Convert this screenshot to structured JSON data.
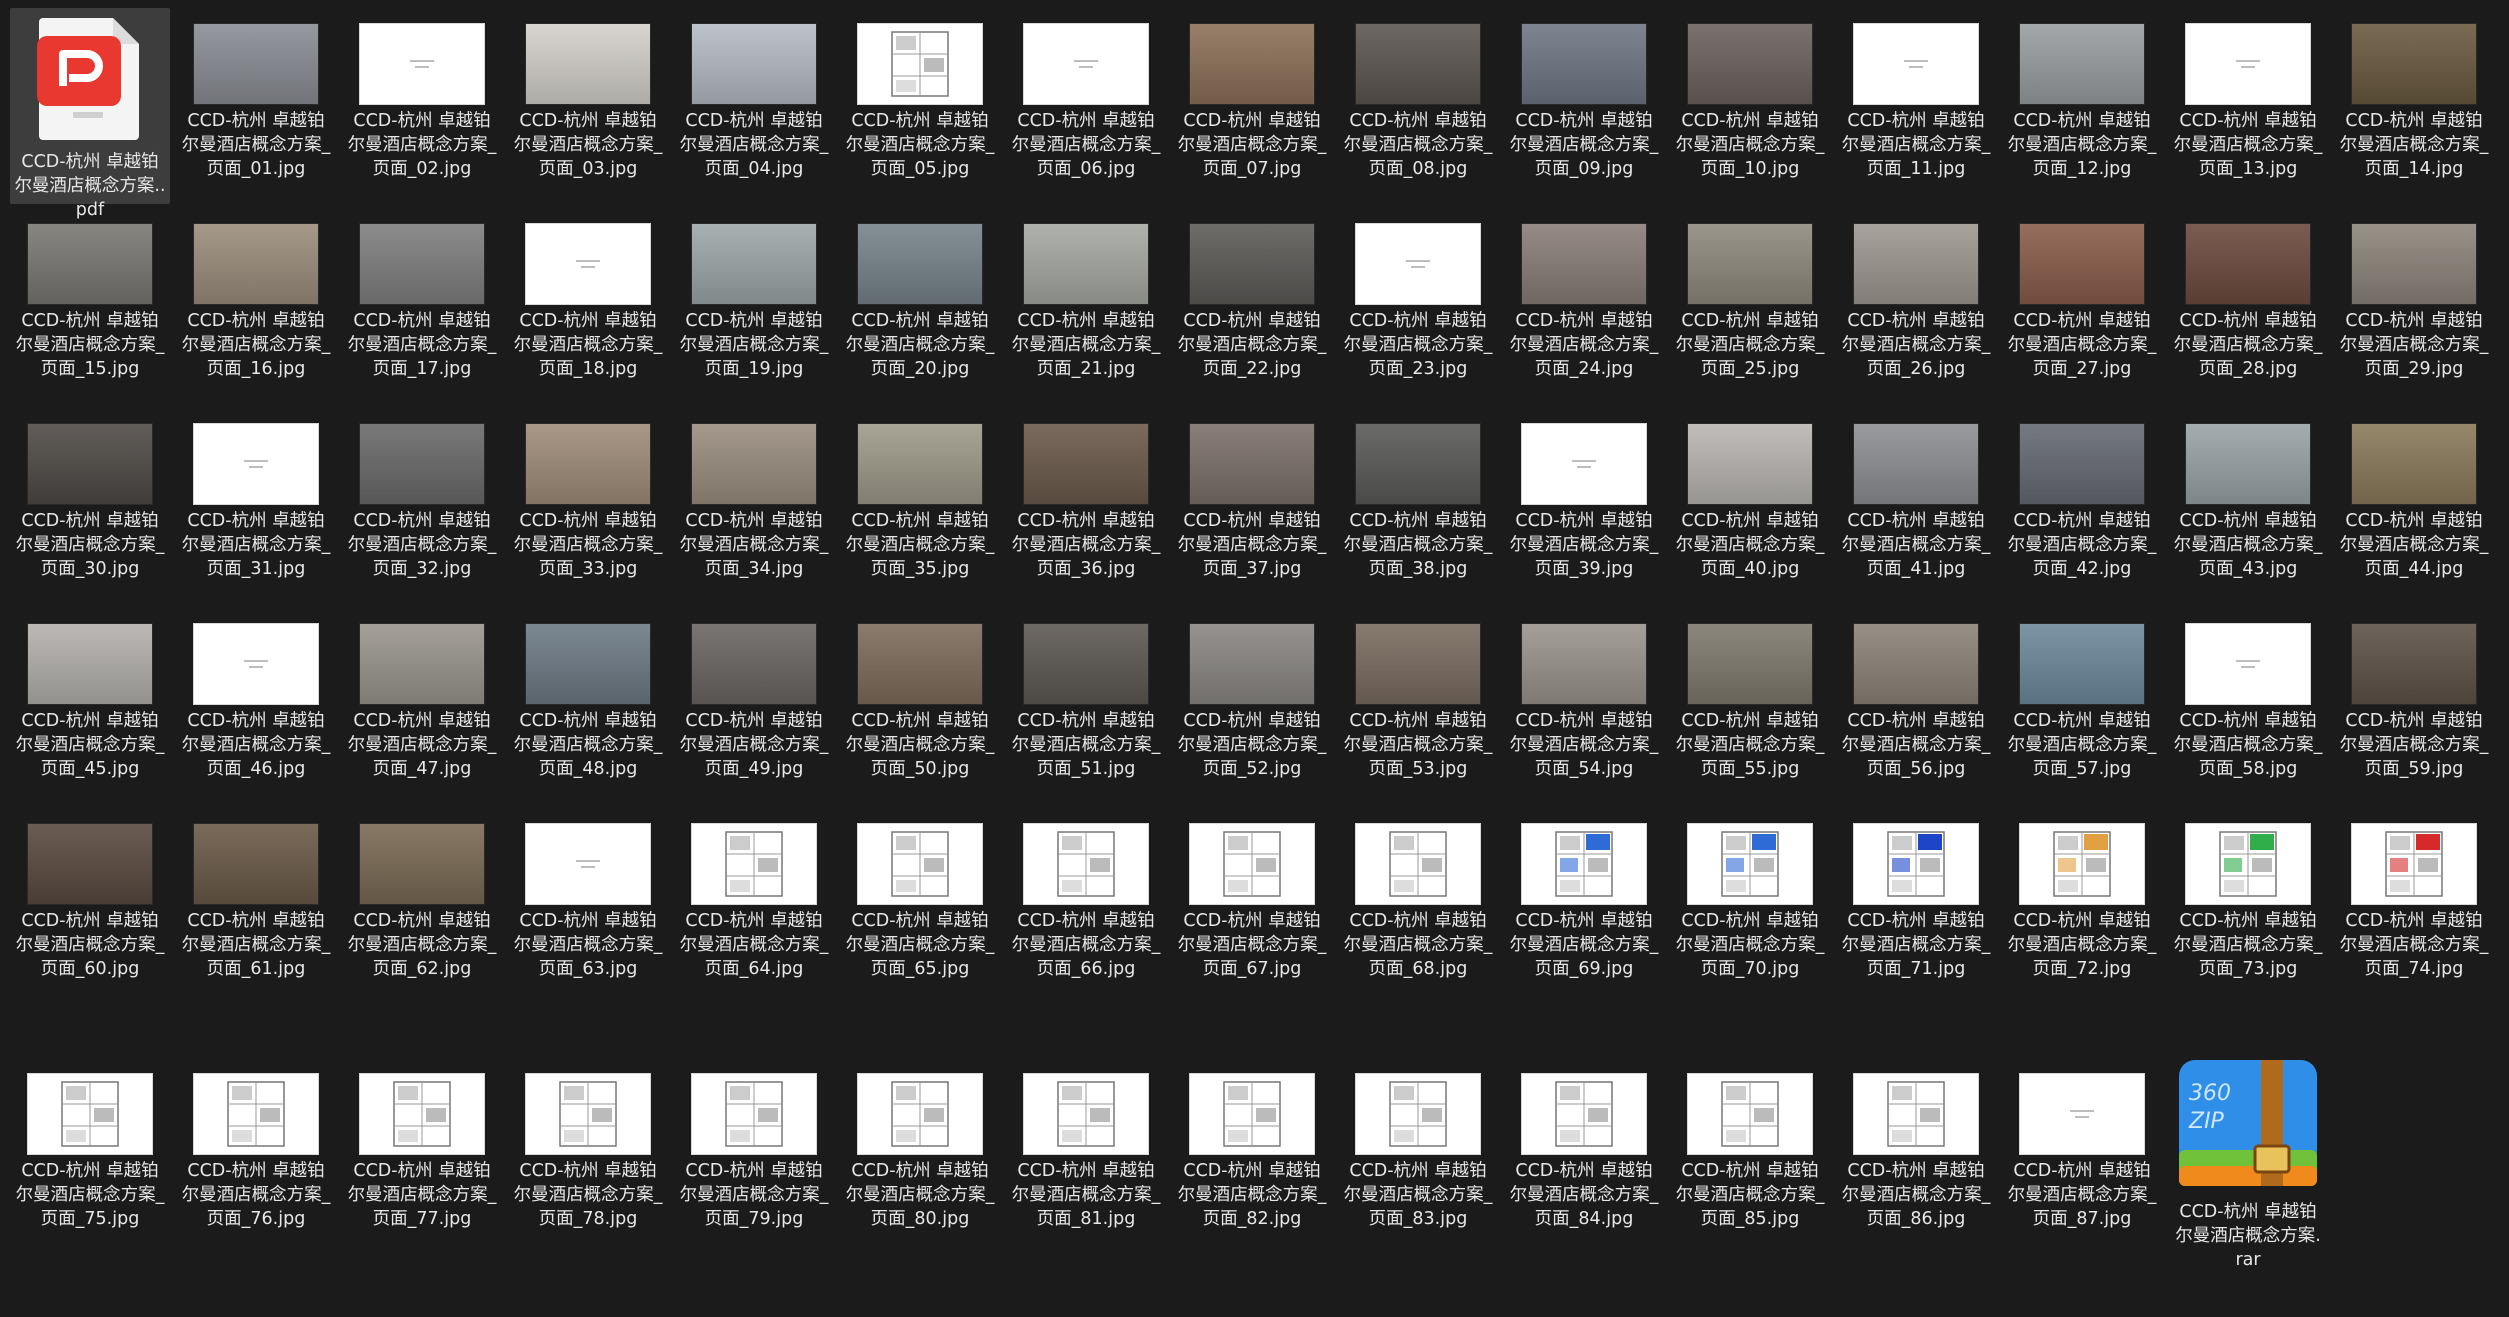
{
  "window": {
    "title": ""
  },
  "items": [
    {
      "type": "pdf",
      "name": "CCD-杭州 卓越铂尔曼酒店概念方案..pdf",
      "selected": true
    },
    {
      "type": "photo",
      "name": "CCD-杭州 卓越铂尔曼酒店概念方案_页面_01.jpg",
      "color": "#8a8d94"
    },
    {
      "type": "text",
      "name": "CCD-杭州 卓越铂尔曼酒店概念方案_页面_02.jpg"
    },
    {
      "type": "photo",
      "name": "CCD-杭州 卓越铂尔曼酒店概念方案_页面_03.jpg",
      "color": "#d4d1cc"
    },
    {
      "type": "photo",
      "name": "CCD-杭州 卓越铂尔曼酒店概念方案_页面_04.jpg",
      "color": "#b6bcc5"
    },
    {
      "type": "plan",
      "name": "CCD-杭州 卓越铂尔曼酒店概念方案_页面_05.jpg"
    },
    {
      "type": "text",
      "name": "CCD-杭州 卓越铂尔曼酒店概念方案_页面_06.jpg"
    },
    {
      "type": "photo",
      "name": "CCD-杭州 卓越铂尔曼酒店概念方案_页面_07.jpg",
      "color": "#8c7158"
    },
    {
      "type": "photo",
      "name": "CCD-杭州 卓越铂尔曼酒店概念方案_页面_08.jpg",
      "color": "#5c5651"
    },
    {
      "type": "photo",
      "name": "CCD-杭州 卓越铂尔曼酒店概念方案_页面_09.jpg",
      "color": "#6f7784"
    },
    {
      "type": "photo",
      "name": "CCD-杭州 卓越铂尔曼酒店概念方案_页面_10.jpg",
      "color": "#6b625e"
    },
    {
      "type": "text",
      "name": "CCD-杭州 卓越铂尔曼酒店概念方案_页面_11.jpg"
    },
    {
      "type": "photo",
      "name": "CCD-杭州 卓越铂尔曼酒店概念方案_页面_12.jpg",
      "color": "#9a9ea0"
    },
    {
      "type": "text",
      "name": "CCD-杭州 卓越铂尔曼酒店概念方案_页面_13.jpg"
    },
    {
      "type": "photo",
      "name": "CCD-杭州 卓越铂尔曼酒店概念方案_页面_14.jpg",
      "color": "#6a5a40"
    },
    {
      "type": "photo",
      "name": "CCD-杭州 卓越铂尔曼酒店概念方案_页面_15.jpg",
      "color": "#7a7873"
    },
    {
      "type": "photo",
      "name": "CCD-杭州 卓越铂尔曼酒店概念方案_页面_16.jpg",
      "color": "#9b8d7c"
    },
    {
      "type": "photo",
      "name": "CCD-杭州 卓越铂尔曼酒店概念方案_页面_17.jpg",
      "color": "#7f7f7f"
    },
    {
      "type": "text",
      "name": "CCD-杭州 卓越铂尔曼酒店概念方案_页面_18.jpg"
    },
    {
      "type": "photo",
      "name": "CCD-杭州 卓越铂尔曼酒店概念方案_页面_19.jpg",
      "color": "#9da8a9"
    },
    {
      "type": "photo",
      "name": "CCD-杭州 卓越铂尔曼酒店概念方案_页面_20.jpg",
      "color": "#77838b"
    },
    {
      "type": "photo",
      "name": "CCD-杭州 卓越铂尔曼酒店概念方案_页面_21.jpg",
      "color": "#a7a9a4"
    },
    {
      "type": "photo",
      "name": "CCD-杭州 卓越铂尔曼酒店概念方案_页面_22.jpg",
      "color": "#5d5b58"
    },
    {
      "type": "text",
      "name": "CCD-杭州 卓越铂尔曼酒店概念方案_页面_23.jpg"
    },
    {
      "type": "photo",
      "name": "CCD-杭州 卓越铂尔曼酒店概念方案_页面_24.jpg",
      "color": "#8a7e78"
    },
    {
      "type": "photo",
      "name": "CCD-杭州 卓越铂尔曼酒店概念方案_页面_25.jpg",
      "color": "#8f8a7e"
    },
    {
      "type": "photo",
      "name": "CCD-杭州 卓越铂尔曼酒店概念方案_页面_26.jpg",
      "color": "#9e9891"
    },
    {
      "type": "photo",
      "name": "CCD-杭州 卓越铂尔曼酒店概念方案_页面_27.jpg",
      "color": "#8a5d4a"
    },
    {
      "type": "photo",
      "name": "CCD-杭州 卓越铂尔曼酒店概念方案_页面_28.jpg",
      "color": "#6d4a3e"
    },
    {
      "type": "photo",
      "name": "CCD-杭州 卓越铂尔曼酒店概念方案_页面_29.jpg",
      "color": "#8c857b"
    },
    {
      "type": "photo",
      "name": "CCD-杭州 卓越铂尔曼酒店概念方案_页面_30.jpg",
      "color": "#4f4a46"
    },
    {
      "type": "text",
      "name": "CCD-杭州 卓越铂尔曼酒店概念方案_页面_31.jpg"
    },
    {
      "type": "photo",
      "name": "CCD-杭州 卓越铂尔曼酒店概念方案_页面_32.jpg",
      "color": "#6a6a6a"
    },
    {
      "type": "photo",
      "name": "CCD-杭州 卓越铂尔曼酒店概念方案_页面_33.jpg",
      "color": "#a08d7a"
    },
    {
      "type": "photo",
      "name": "CCD-杭州 卓越铂尔曼酒店概念方案_页面_34.jpg",
      "color": "#9a8e7f"
    },
    {
      "type": "photo",
      "name": "CCD-杭州 卓越铂尔曼酒店概念方案_页面_35.jpg",
      "color": "#9e9a8a"
    },
    {
      "type": "photo",
      "name": "CCD-杭州 卓越铂尔曼酒店概念方案_页面_36.jpg",
      "color": "#6b5a4b"
    },
    {
      "type": "photo",
      "name": "CCD-杭州 卓越铂尔曼酒店概念方案_页面_37.jpg",
      "color": "#7c7069"
    },
    {
      "type": "photo",
      "name": "CCD-杭州 卓越铂尔曼酒店概念方案_页面_38.jpg",
      "color": "#5a5a58"
    },
    {
      "type": "text",
      "name": "CCD-杭州 卓越铂尔曼酒店概念方案_页面_39.jpg"
    },
    {
      "type": "photo",
      "name": "CCD-杭州 卓越铂尔曼酒店概念方案_页面_40.jpg",
      "color": "#b9b6b2"
    },
    {
      "type": "photo",
      "name": "CCD-杭州 卓越铂尔曼酒店概念方案_页面_41.jpg",
      "color": "#8d8f93"
    },
    {
      "type": "photo",
      "name": "CCD-杭州 卓越铂尔曼酒店概念方案_页面_42.jpg",
      "color": "#666a73"
    },
    {
      "type": "photo",
      "name": "CCD-杭州 卓越铂尔曼酒店概念方案_页面_43.jpg",
      "color": "#9aa3a7"
    },
    {
      "type": "photo",
      "name": "CCD-杭州 卓越铂尔曼酒店概念方案_页面_44.jpg",
      "color": "#8a7a5a"
    },
    {
      "type": "photo",
      "name": "CCD-杭州 卓越铂尔曼酒店概念方案_页面_45.jpg",
      "color": "#b4b1ad"
    },
    {
      "type": "text",
      "name": "CCD-杭州 卓越铂尔曼酒店概念方案_页面_46.jpg"
    },
    {
      "type": "photo",
      "name": "CCD-杭州 卓越铂尔曼酒店概念方案_页面_47.jpg",
      "color": "#9a958e"
    },
    {
      "type": "photo",
      "name": "CCD-杭州 卓越铂尔曼酒店概念方案_页面_48.jpg",
      "color": "#6d7a85"
    },
    {
      "type": "photo",
      "name": "CCD-杭州 卓越铂尔曼酒店概念方案_页面_49.jpg",
      "color": "#6a6664"
    },
    {
      "type": "photo",
      "name": "CCD-杭州 卓越铂尔曼酒店概念方案_页面_50.jpg",
      "color": "#7e6c5b"
    },
    {
      "type": "photo",
      "name": "CCD-杭州 卓越铂尔曼酒店概念方案_页面_51.jpg",
      "color": "#5d5853"
    },
    {
      "type": "photo",
      "name": "CCD-杭州 卓越铂尔曼酒店概念方案_页面_52.jpg",
      "color": "#8a8784"
    },
    {
      "type": "photo",
      "name": "CCD-杭州 卓越铂尔曼酒店概念方案_页面_53.jpg",
      "color": "#7a6c60"
    },
    {
      "type": "photo",
      "name": "CCD-杭州 卓越铂尔曼酒店概念方案_页面_54.jpg",
      "color": "#9a948b"
    },
    {
      "type": "photo",
      "name": "CCD-杭州 卓越铂尔曼酒店概念方案_页面_55.jpg",
      "color": "#7f7a6e"
    },
    {
      "type": "photo",
      "name": "CCD-杭州 卓越铂尔曼酒店概念方案_页面_56.jpg",
      "color": "#8c8378"
    },
    {
      "type": "photo",
      "name": "CCD-杭州 卓越铂尔曼酒店概念方案_页面_57.jpg",
      "color": "#6d8a9c"
    },
    {
      "type": "text",
      "name": "CCD-杭州 卓越铂尔曼酒店概念方案_页面_58.jpg"
    },
    {
      "type": "photo",
      "name": "CCD-杭州 卓越铂尔曼酒店概念方案_页面_59.jpg",
      "color": "#5e5248"
    },
    {
      "type": "photo",
      "name": "CCD-杭州 卓越铂尔曼酒店概念方案_页面_60.jpg",
      "color": "#5a4a40"
    },
    {
      "type": "photo",
      "name": "CCD-杭州 卓越铂尔曼酒店概念方案_页面_61.jpg",
      "color": "#6b5a48"
    },
    {
      "type": "photo",
      "name": "CCD-杭州 卓越铂尔曼酒店概念方案_页面_62.jpg",
      "color": "#7a6a54"
    },
    {
      "type": "text",
      "name": "CCD-杭州 卓越铂尔曼酒店概念方案_页面_63.jpg"
    },
    {
      "type": "plan",
      "name": "CCD-杭州 卓越铂尔曼酒店概念方案_页面_64.jpg"
    },
    {
      "type": "plan",
      "name": "CCD-杭州 卓越铂尔曼酒店概念方案_页面_65.jpg"
    },
    {
      "type": "plan",
      "name": "CCD-杭州 卓越铂尔曼酒店概念方案_页面_66.jpg"
    },
    {
      "type": "plan",
      "name": "CCD-杭州 卓越铂尔曼酒店概念方案_页面_67.jpg"
    },
    {
      "type": "plan",
      "name": "CCD-杭州 卓越铂尔曼酒店概念方案_页面_68.jpg"
    },
    {
      "type": "plan",
      "name": "CCD-杭州 卓越铂尔曼酒店概念方案_页面_69.jpg",
      "accent": "#2f6bd6"
    },
    {
      "type": "plan",
      "name": "CCD-杭州 卓越铂尔曼酒店概念方案_页面_70.jpg",
      "accent": "#2f6bd6"
    },
    {
      "type": "plan",
      "name": "CCD-杭州 卓越铂尔曼酒店概念方案_页面_71.jpg",
      "accent": "#1e45c8"
    },
    {
      "type": "plan",
      "name": "CCD-杭州 卓越铂尔曼酒店概念方案_页面_72.jpg",
      "accent": "#e0a040"
    },
    {
      "type": "plan",
      "name": "CCD-杭州 卓越铂尔曼酒店概念方案_页面_73.jpg",
      "accent": "#2fae4a"
    },
    {
      "type": "plan",
      "name": "CCD-杭州 卓越铂尔曼酒店概念方案_页面_74.jpg",
      "accent": "#d62a2a"
    },
    {
      "type": "plan",
      "name": "CCD-杭州 卓越铂尔曼酒店概念方案_页面_75.jpg"
    },
    {
      "type": "plan",
      "name": "CCD-杭州 卓越铂尔曼酒店概念方案_页面_76.jpg"
    },
    {
      "type": "plan",
      "name": "CCD-杭州 卓越铂尔曼酒店概念方案_页面_77.jpg"
    },
    {
      "type": "plan",
      "name": "CCD-杭州 卓越铂尔曼酒店概念方案_页面_78.jpg"
    },
    {
      "type": "plan",
      "name": "CCD-杭州 卓越铂尔曼酒店概念方案_页面_79.jpg"
    },
    {
      "type": "plan",
      "name": "CCD-杭州 卓越铂尔曼酒店概念方案_页面_80.jpg"
    },
    {
      "type": "plan",
      "name": "CCD-杭州 卓越铂尔曼酒店概念方案_页面_81.jpg"
    },
    {
      "type": "plan",
      "name": "CCD-杭州 卓越铂尔曼酒店概念方案_页面_82.jpg"
    },
    {
      "type": "plan",
      "name": "CCD-杭州 卓越铂尔曼酒店概念方案_页面_83.jpg"
    },
    {
      "type": "plan",
      "name": "CCD-杭州 卓越铂尔曼酒店概念方案_页面_84.jpg"
    },
    {
      "type": "plan",
      "name": "CCD-杭州 卓越铂尔曼酒店概念方案_页面_85.jpg"
    },
    {
      "type": "plan",
      "name": "CCD-杭州 卓越铂尔曼酒店概念方案_页面_86.jpg"
    },
    {
      "type": "text",
      "name": "CCD-杭州 卓越铂尔曼酒店概念方案_页面_87.jpg"
    },
    {
      "type": "rar",
      "name": "CCD-杭州 卓越铂尔曼酒店概念方案.rar"
    }
  ],
  "icons": {
    "pdf": "pdf-file-icon",
    "rar": "360zip-archive-icon",
    "pdf_color": "#e8382f",
    "zip_color": "#2f8fe8"
  }
}
